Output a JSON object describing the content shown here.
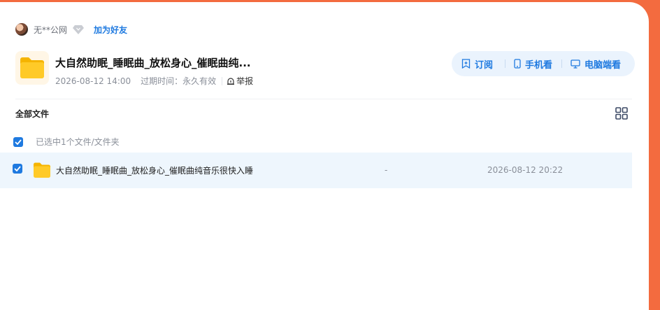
{
  "user": {
    "name": "无**公网",
    "add_friend": "加为好友"
  },
  "share": {
    "title": "大自然助眠_睡眠曲_放松身心_催眠曲纯...",
    "date": "2026-08-12 14:00",
    "expiry_label": "过期时间：",
    "expiry_value": "永久有效",
    "report": "举报"
  },
  "actions": {
    "subscribe": "订阅",
    "mobile": "手机看",
    "desktop": "电脑端看"
  },
  "files": {
    "section_title": "全部文件",
    "selection_text": "已选中1个文件/文件夹",
    "rows": [
      {
        "name": "大自然助眠_睡眠曲_放松身心_催眠曲纯音乐很快入睡",
        "size": "-",
        "date": "2026-08-12 20:22"
      }
    ]
  },
  "colors": {
    "background": "#f36b3f",
    "accent": "#1f7ae0",
    "selected_row": "#eef6fd"
  }
}
